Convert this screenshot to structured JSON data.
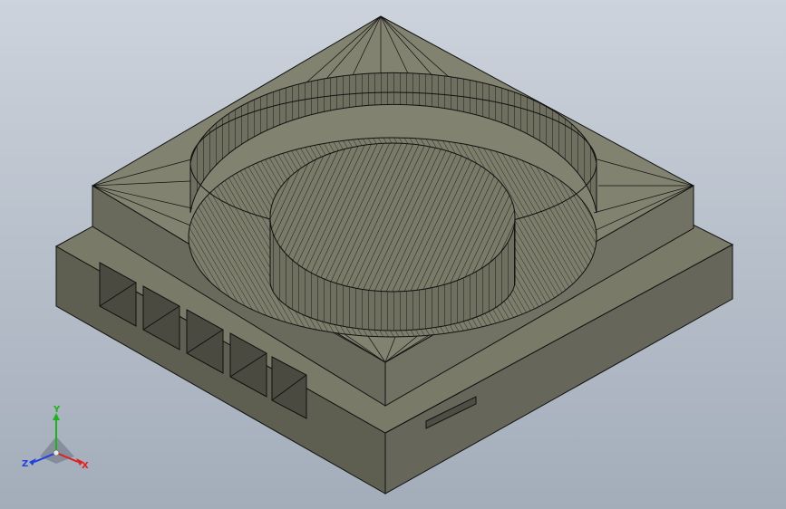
{
  "viewport": {
    "background_top": "#cdd3dc",
    "background_bottom": "#a3adba"
  },
  "model": {
    "description_name": "square-base-with-circular-pocket-and-boss",
    "face_color": "#6e6e5f",
    "face_light": "#8a8a78",
    "face_dark": "#55554a",
    "edge_color": "#111111"
  },
  "triad": {
    "x_label": "X",
    "y_label": "Y",
    "z_label": "Z",
    "x_color": "#e02020",
    "y_color": "#20b020",
    "z_color": "#2040e0"
  }
}
